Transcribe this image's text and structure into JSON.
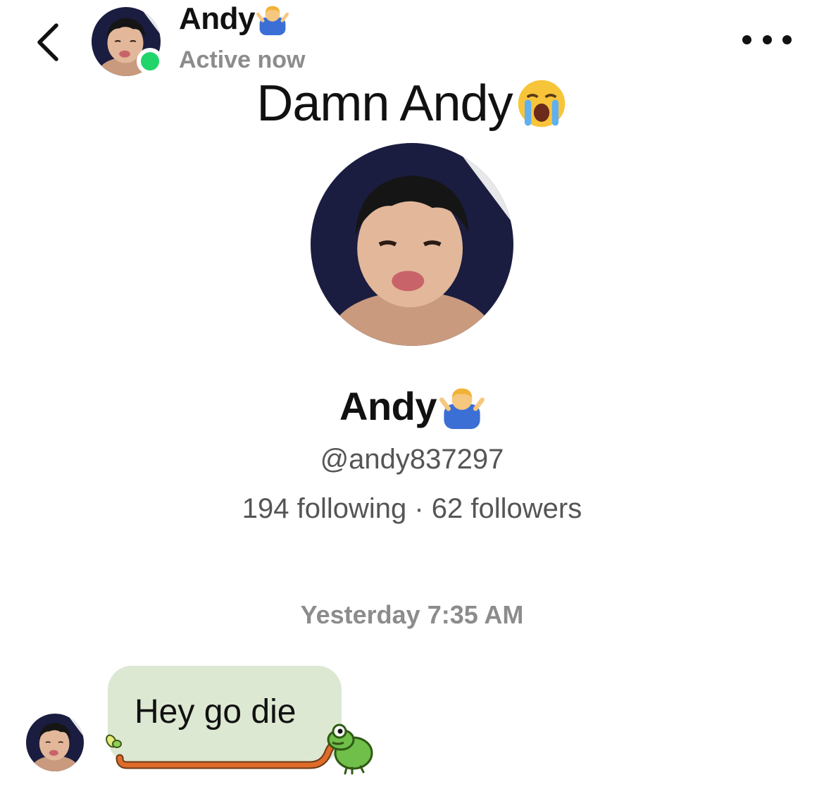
{
  "header": {
    "name": "Andy",
    "name_emoji": "man-shrugging",
    "status": "Active now",
    "back_icon": "chevron-left-icon",
    "more_icon": "more-horizontal-icon",
    "online_color": "#20d56a"
  },
  "chat": {
    "title": "Damn Andy",
    "title_emoji": "loudly-crying-face"
  },
  "profile": {
    "name": "Andy",
    "name_emoji": "man-shrugging",
    "handle": "@andy837297",
    "following": "194 following",
    "separator": " · ",
    "followers": "62 followers"
  },
  "conversation": {
    "timestamp": "Yesterday 7:35 AM",
    "messages": [
      {
        "sender": "Andy",
        "text": "Hey go die",
        "bubble_color": "#dde8d3",
        "decoration": "frog-tongue-sticker"
      }
    ]
  }
}
